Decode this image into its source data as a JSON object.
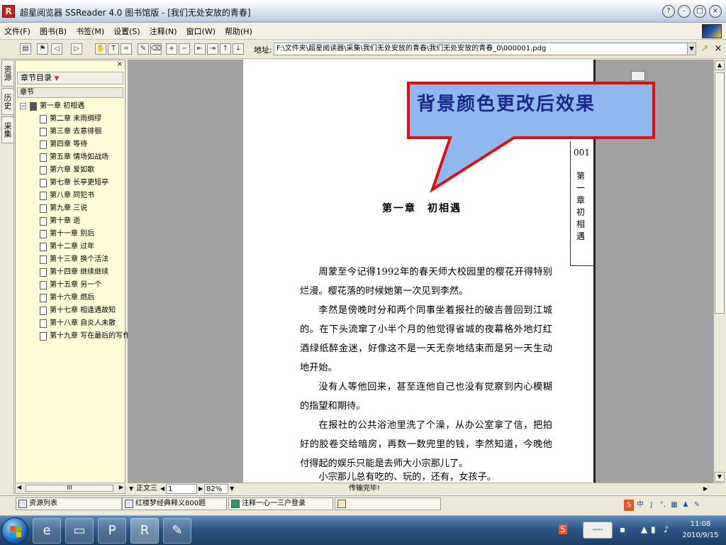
{
  "window": {
    "title": "超星阅览器 SSReader 4.0 图书馆版 - [我们无处安放的青春]",
    "controls": [
      "?",
      "–",
      "□",
      "×"
    ]
  },
  "menu": [
    "文件(F)",
    "图书(B)",
    "书签(M)",
    "设置(S)",
    "注释(N)",
    "窗口(W)",
    "帮助(H)"
  ],
  "toolbar": {
    "address_label": "地址:",
    "address_value": "F:\\文件夹\\超星阅读器\\采集\\我们无处安放的青春\\我们无处安放的青春_0\\000001.pdg"
  },
  "side_tabs": [
    "资源",
    "历史",
    "采集"
  ],
  "catalog": {
    "header": "章节目录",
    "column": "章节",
    "items": [
      {
        "label": "第一章 初相遇",
        "level": 0
      },
      {
        "label": "第二章 未雨绸缪",
        "level": 1
      },
      {
        "label": "第三章 去意徘徊",
        "level": 1
      },
      {
        "label": "第四章 等待",
        "level": 1
      },
      {
        "label": "第五章 情场如战场",
        "level": 1
      },
      {
        "label": "第六章 爱如歌",
        "level": 1
      },
      {
        "label": "第七章 长亭更短亭",
        "level": 1
      },
      {
        "label": "第八章 同犯书",
        "level": 1
      },
      {
        "label": "第九章 三说",
        "level": 1
      },
      {
        "label": "第十章 逝",
        "level": 1
      },
      {
        "label": "第十一章 别后",
        "level": 1
      },
      {
        "label": "第十二章 过年",
        "level": 1
      },
      {
        "label": "第十三章 换个活法",
        "level": 1
      },
      {
        "label": "第十四章 继续继续",
        "level": 1
      },
      {
        "label": "第十五章 另一个",
        "level": 1
      },
      {
        "label": "第十六章 燃后",
        "level": 1
      },
      {
        "label": "第十七章 相逢遇故知",
        "level": 1
      },
      {
        "label": "第十八章 自炎人未散",
        "level": 1
      },
      {
        "label": "第十九章 写在最后的写作",
        "level": 1
      }
    ],
    "hscroll_thumb": "III"
  },
  "page": {
    "callout": "背景颜色更改后效果",
    "chapter_title": "第一章　初相遇",
    "page_number": "001",
    "vertical_chapter": "第一章 初相遇",
    "paragraphs": [
      "周蒙至今记得1992年的春天师大校园里的樱花开得特别烂漫。樱花落的时候她第一次见到李然。",
      "李然是傍晚时分和两个同事坐着报社的破吉普回到江城的。在下头流窜了小半个月的他觉得省城的夜幕格外地灯红酒绿纸醉金迷，好像这不是一天无奈地结束而是另一天生动地开始。",
      "没有人等他回来，甚至连他自己也没有觉察到内心模糊的指望和期待。",
      "在报社的公共浴池里洗了个澡，从办公室拿了信，把拍好的胶卷交给暗房，再数一数兜里的钱，李然知道，今晚他付得起的娱乐只能是去师大小宗那儿了。",
      "小宗那儿总有吃的、玩的，还有，女孩子。"
    ]
  },
  "status": {
    "mode": "正文三",
    "page_input": "1",
    "zoom": "82%",
    "message": "传输完毕!"
  },
  "bottom_tasks": [
    "资源列表",
    "红楼梦经典释义800题",
    "注释一心一三户登录",
    ""
  ],
  "ime": [
    "S",
    "中",
    "J",
    "°,",
    "▦",
    "♟",
    "✎"
  ],
  "taskbar": {
    "apps": [
      "IE",
      "Explorer",
      "PowerPoint",
      "SSReader",
      "Paint"
    ],
    "tray_box": "----",
    "time": "11:08",
    "date": "2010/9/15"
  },
  "colors": {
    "callout_fill": "#8fb8ee",
    "callout_border": "#e01010",
    "callout_text": "#1a2a8a",
    "catalog_bg": "#fdfbd8",
    "viewer_bg": "#a1a1a1",
    "app_icon": "#c8201c"
  }
}
